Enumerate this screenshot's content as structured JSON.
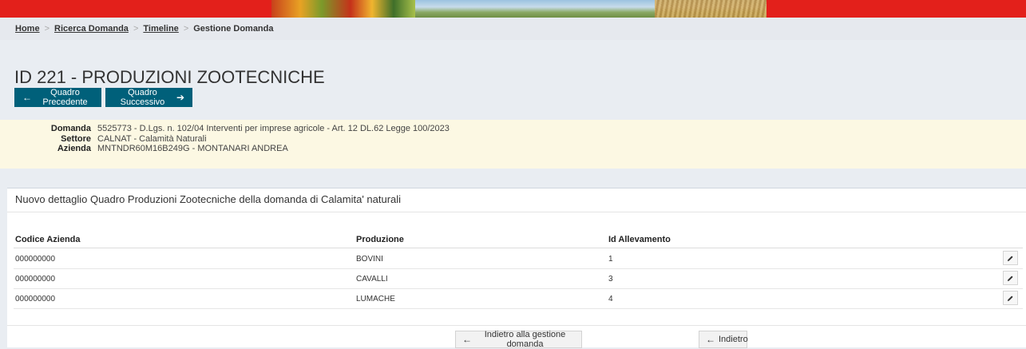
{
  "breadcrumb": {
    "items": [
      "Home",
      "Ricerca Domanda",
      "Timeline"
    ],
    "current": "Gestione Domanda",
    "separator": ">"
  },
  "page": {
    "title": "ID 221 - PRODUZIONI ZOOTECNICHE"
  },
  "nav": {
    "prev_label": "Quadro Precedente",
    "next_label": "Quadro Successivo",
    "prev_icon": "←",
    "next_icon": "➔"
  },
  "info": {
    "domanda_label": "Domanda",
    "domanda_value": "5525773 - D.Lgs. n. 102/04 Interventi per imprese agricole - Art. 12 DL.62 Legge 100/2023",
    "settore_label": "Settore",
    "settore_value": "CALNAT - Calamità Naturali",
    "azienda_label": "Azienda",
    "azienda_value": "MNTNDR60M16B249G - MONTANARI ANDREA"
  },
  "panel": {
    "title": "Nuovo dettaglio Quadro Produzioni Zootecniche della domanda di Calamita' naturali"
  },
  "table": {
    "headers": [
      "Codice Azienda",
      "Produzione",
      "Id Allevamento"
    ],
    "rows": [
      {
        "codice": "000000000",
        "produzione": "BOVINI",
        "id": "1"
      },
      {
        "codice": "000000000",
        "produzione": "CAVALLI",
        "id": "3"
      },
      {
        "codice": "000000000",
        "produzione": "LUMACHE",
        "id": "4"
      }
    ],
    "edit_icon": "pencil-icon"
  },
  "footer": {
    "back_gestione_label": "Indietro alla gestione domanda",
    "back_label": "Indietro",
    "icon": "←"
  },
  "colors": {
    "primary_button": "#00607a",
    "banner_red": "#e3201b",
    "info_background": "#fcf8e3"
  }
}
